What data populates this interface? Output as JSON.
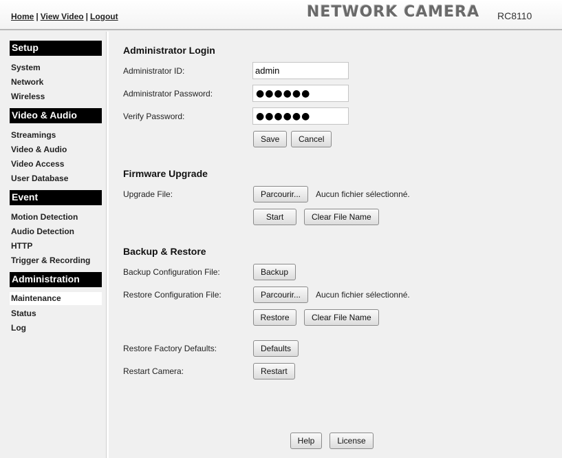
{
  "header": {
    "links": [
      "Home",
      "View Video",
      "Logout"
    ],
    "separator": "|",
    "brand": "NETWORK CAMERA",
    "model": "RC8110"
  },
  "sidebar": {
    "sections": [
      {
        "title": "Setup",
        "items": [
          "System",
          "Network",
          "Wireless"
        ]
      },
      {
        "title": "Video & Audio",
        "items": [
          "Streamings",
          "Video & Audio",
          "Video Access",
          "User Database"
        ]
      },
      {
        "title": "Event",
        "items": [
          "Motion Detection",
          "Audio Detection",
          "HTTP",
          "Trigger & Recording"
        ]
      },
      {
        "title": "Administration",
        "items": [
          "Maintenance",
          "Status",
          "Log"
        ]
      }
    ],
    "active_item": "Maintenance"
  },
  "admin_login": {
    "title": "Administrator Login",
    "id_label": "Administrator ID:",
    "id_value": "admin",
    "password_label": "Administrator Password:",
    "password_mask": "●●●●●●",
    "verify_label": "Verify Password:",
    "verify_mask": "●●●●●●",
    "save_label": "Save",
    "cancel_label": "Cancel"
  },
  "firmware": {
    "title": "Firmware Upgrade",
    "file_label": "Upgrade File:",
    "browse_label": "Parcourir...",
    "file_status": "Aucun fichier sélectionné.",
    "start_label": "Start",
    "clear_label": "Clear File Name"
  },
  "backup": {
    "title": "Backup & Restore",
    "backup_label": "Backup Configuration File:",
    "backup_button": "Backup",
    "restore_label": "Restore Configuration File:",
    "browse_label": "Parcourir...",
    "file_status": "Aucun fichier sélectionné.",
    "restore_button": "Restore",
    "clear_label": "Clear File Name",
    "defaults_label": "Restore Factory Defaults:",
    "defaults_button": "Defaults",
    "restart_label": "Restart Camera:",
    "restart_button": "Restart"
  },
  "footer": {
    "help_label": "Help",
    "license_label": "License"
  }
}
